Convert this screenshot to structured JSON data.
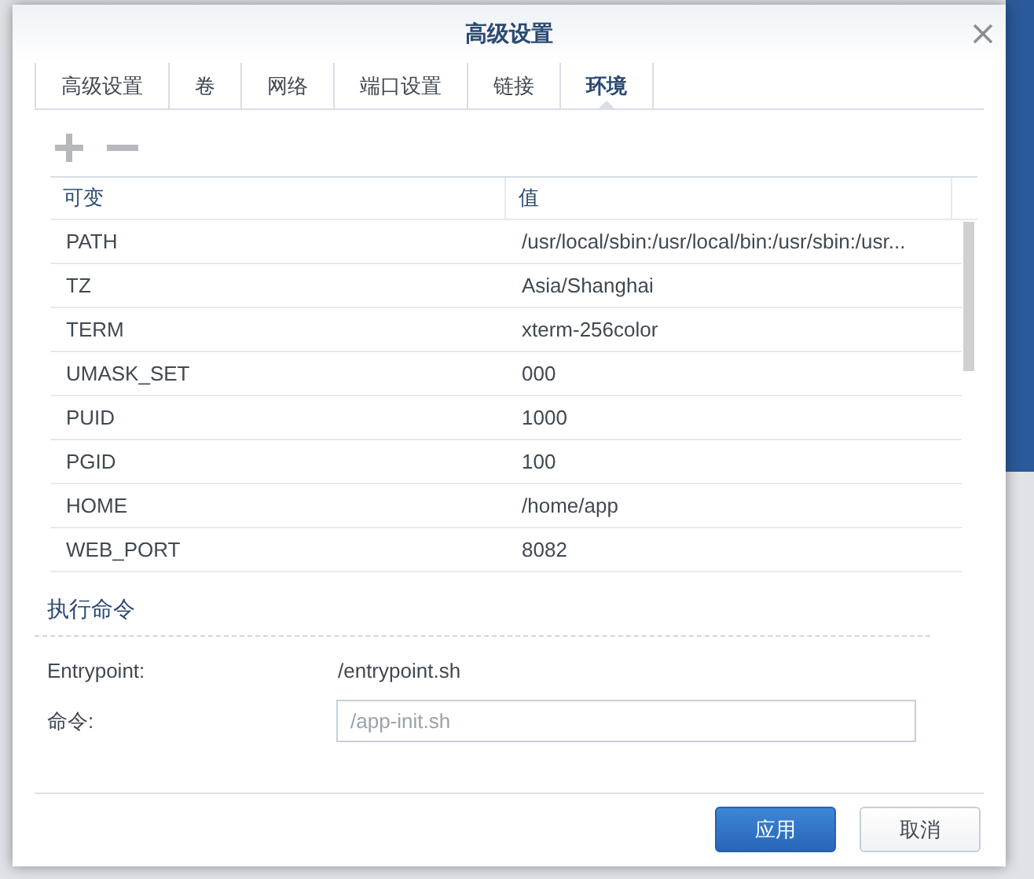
{
  "dialog": {
    "title": "高级设置"
  },
  "tabs": [
    {
      "label": "高级设置",
      "selected": false
    },
    {
      "label": "卷",
      "selected": false
    },
    {
      "label": "网络",
      "selected": false
    },
    {
      "label": "端口设置",
      "selected": false
    },
    {
      "label": "链接",
      "selected": false
    },
    {
      "label": "环境",
      "selected": true
    }
  ],
  "table": {
    "columns": [
      "可变",
      "值"
    ],
    "rows": [
      {
        "name": "PATH",
        "value": "/usr/local/sbin:/usr/local/bin:/usr/sbin:/usr..."
      },
      {
        "name": "TZ",
        "value": "Asia/Shanghai"
      },
      {
        "name": "TERM",
        "value": "xterm-256color"
      },
      {
        "name": "UMASK_SET",
        "value": "000"
      },
      {
        "name": "PUID",
        "value": "1000"
      },
      {
        "name": "PGID",
        "value": "100"
      },
      {
        "name": "HOME",
        "value": "/home/app"
      },
      {
        "name": "WEB_PORT",
        "value": "8082"
      }
    ]
  },
  "command_section": {
    "title": "执行命令",
    "entrypoint_label": "Entrypoint:",
    "entrypoint_value": "/entrypoint.sh",
    "command_label": "命令:",
    "command_placeholder": "/app-init.sh"
  },
  "buttons": [
    {
      "label": "应用",
      "kind": "primary"
    },
    {
      "label": "取消",
      "kind": "secondary"
    }
  ]
}
